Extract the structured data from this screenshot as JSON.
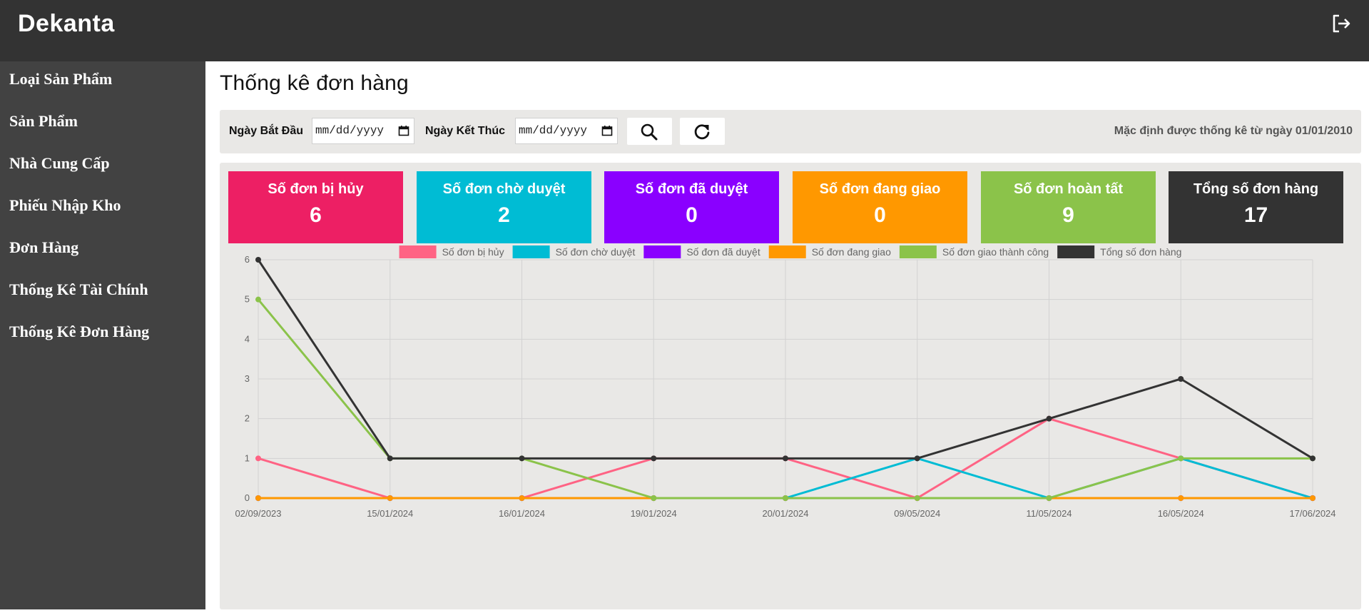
{
  "app": {
    "brand": "Dekanta"
  },
  "sidebar": {
    "items": [
      {
        "label": "Loại Sản Phẩm"
      },
      {
        "label": "Sản Phẩm"
      },
      {
        "label": "Nhà Cung Cấp"
      },
      {
        "label": "Phiếu Nhập Kho"
      },
      {
        "label": "Đơn Hàng"
      },
      {
        "label": "Thống Kê Tài Chính"
      },
      {
        "label": "Thống Kê Đơn Hàng"
      }
    ]
  },
  "main": {
    "title": "Thống kê đơn hàng",
    "filter": {
      "start_label": "Ngày Bắt Đầu",
      "start_placeholder": "mm/dd/yyyy",
      "end_label": "Ngày Kết Thúc",
      "end_placeholder": "mm/dd/yyyy",
      "note": "Mặc định được thống kê từ ngày 01/01/2010"
    },
    "cards": [
      {
        "title": "Số đơn bị hủy",
        "value": "6",
        "color": "#ed1f64"
      },
      {
        "title": "Số đơn chờ duyệt",
        "value": "2",
        "color": "#00bcd4"
      },
      {
        "title": "Số đơn đã duyệt",
        "value": "0",
        "color": "#8a00ff"
      },
      {
        "title": "Số đơn đang giao",
        "value": "0",
        "color": "#ff9800"
      },
      {
        "title": "Số đơn hoàn tất",
        "value": "9",
        "color": "#8bc34a"
      },
      {
        "title": "Tổng số đơn hàng",
        "value": "17",
        "color": "#333333"
      }
    ]
  },
  "icons": {
    "logout": "logout-icon",
    "search": "search-icon",
    "refresh": "refresh-icon",
    "calendar": "calendar-icon"
  },
  "chart_data": {
    "type": "line",
    "categories": [
      "02/09/2023",
      "15/01/2024",
      "16/01/2024",
      "19/01/2024",
      "20/01/2024",
      "09/05/2024",
      "11/05/2024",
      "16/05/2024",
      "17/06/2024"
    ],
    "ylim": [
      0,
      6
    ],
    "yticks": [
      "0",
      "1",
      "2",
      "3",
      "4",
      "5",
      "6"
    ],
    "grid": true,
    "legend": "top",
    "series": [
      {
        "name": "Số đơn bị hủy",
        "color": "#ff6384",
        "values": [
          1,
          0,
          0,
          1,
          1,
          0,
          2,
          1,
          0
        ]
      },
      {
        "name": "Số đơn chờ duyệt",
        "color": "#00bcd4",
        "values": [
          0,
          0,
          0,
          0,
          0,
          1,
          0,
          1,
          0
        ]
      },
      {
        "name": "Số đơn đã duyệt",
        "color": "#8a00ff",
        "values": [
          0,
          0,
          0,
          0,
          0,
          0,
          0,
          0,
          0
        ]
      },
      {
        "name": "Số đơn đang giao",
        "color": "#ff9800",
        "values": [
          0,
          0,
          0,
          0,
          0,
          0,
          0,
          0,
          0
        ]
      },
      {
        "name": "Số đơn giao thành công",
        "color": "#8bc34a",
        "values": [
          5,
          1,
          1,
          0,
          0,
          0,
          0,
          1,
          1
        ]
      },
      {
        "name": "Tổng số đơn hàng",
        "color": "#333333",
        "values": [
          6,
          1,
          1,
          1,
          1,
          1,
          2,
          3,
          1
        ]
      }
    ]
  }
}
